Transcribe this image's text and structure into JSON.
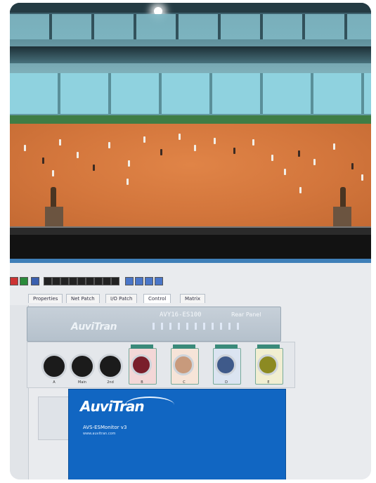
{
  "photo": {
    "scene": "stadium-with-laptop-screen"
  },
  "app": {
    "tabs": [
      {
        "label": "Properties"
      },
      {
        "label": "Net Patch"
      },
      {
        "label": "I/O Patch"
      },
      {
        "label": "Control"
      },
      {
        "label": "Matrix"
      }
    ],
    "device": {
      "brand": "AuviTran",
      "model": "AVY16-ES100",
      "panel": "Rear Panel"
    },
    "jacks": [
      "A",
      "Main",
      "2nd",
      "B",
      "C",
      "D",
      "E"
    ],
    "splash": {
      "brand": "AuviTran",
      "version": "AVS-ESMonitor v3",
      "url": "www.auvitran.com"
    }
  },
  "colors": {
    "field": "#d6773c",
    "seats": "#7db8c4",
    "splash": "#1166c2",
    "bezel": "#121212"
  }
}
